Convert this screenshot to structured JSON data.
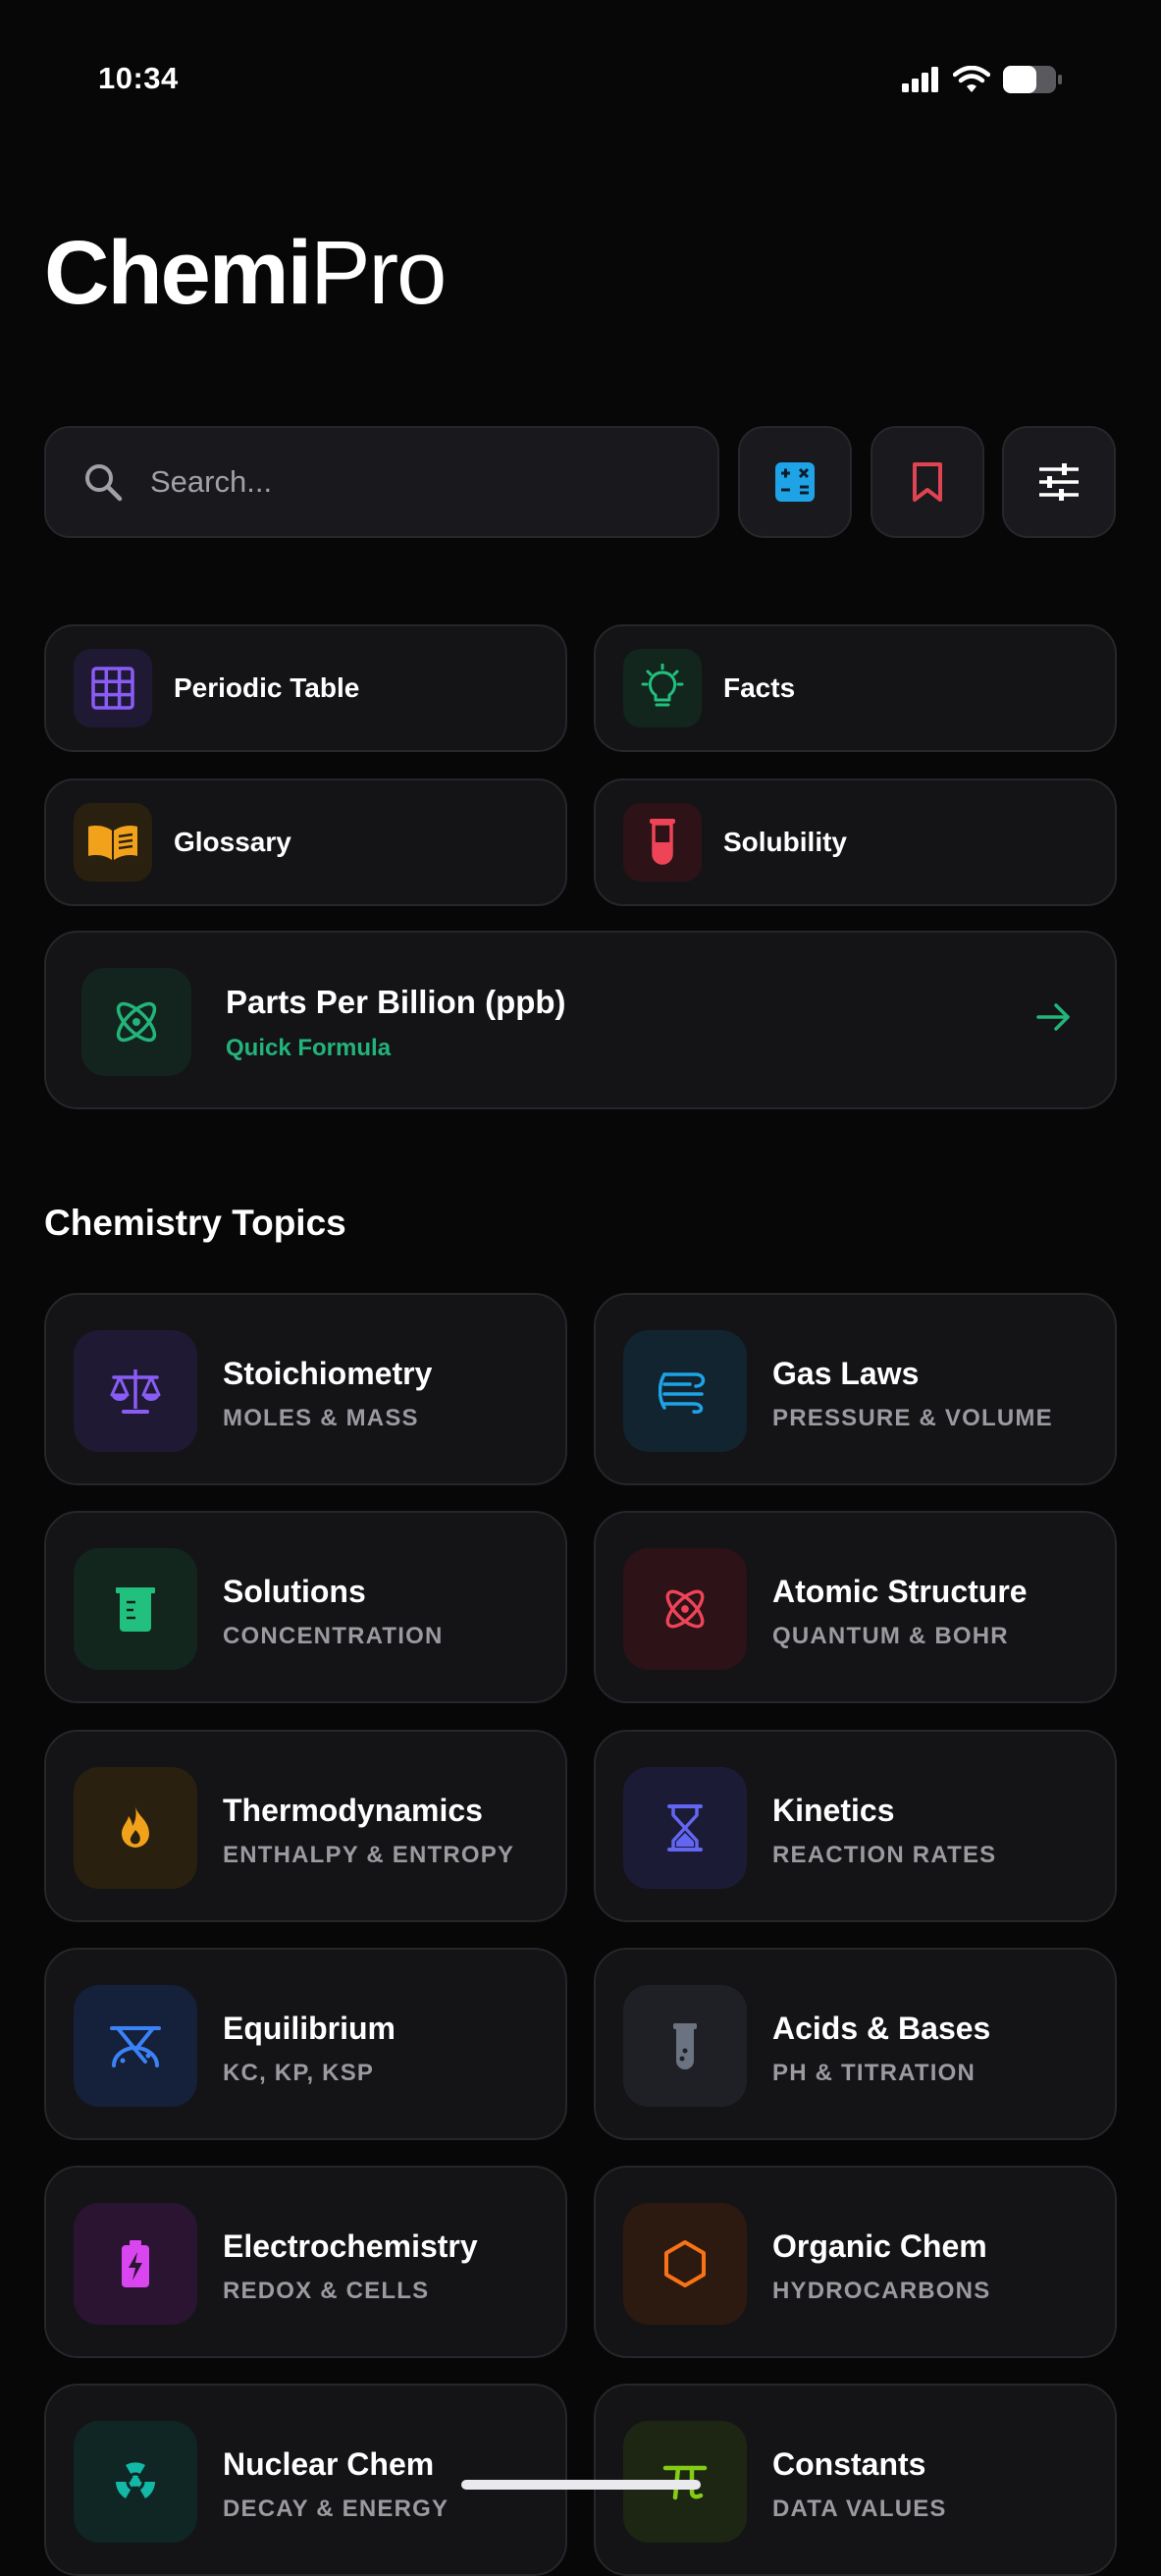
{
  "status_bar": {
    "time": "10:34"
  },
  "app": {
    "name_bold": "Chemi",
    "name_light": "Pro"
  },
  "search": {
    "placeholder": "Search..."
  },
  "toolbar": [
    {
      "icon": "calculator-icon",
      "color": "#1ea3e6"
    },
    {
      "icon": "bookmark-icon",
      "color": "#e04352"
    },
    {
      "icon": "sliders-icon",
      "color": "#ffffff"
    }
  ],
  "quick_links": [
    {
      "label": "Periodic Table",
      "icon": "grid-icon",
      "color": "#8a5cf6"
    },
    {
      "label": "Facts",
      "icon": "lightbulb-icon",
      "color": "#22c07f"
    },
    {
      "label": "Glossary",
      "icon": "book-icon",
      "color": "#f2a21a"
    },
    {
      "label": "Solubility",
      "icon": "test-tube-icon",
      "color": "#ef4458"
    }
  ],
  "featured": {
    "title": "Parts Per Billion (ppb)",
    "subtitle": "Quick Formula",
    "accent": "#22b47a"
  },
  "topics_heading": "Chemistry Topics",
  "topics": [
    {
      "name": "Stoichiometry",
      "sub": "MOLES & MASS",
      "icon": "scale-icon",
      "color": "#8a5cf6"
    },
    {
      "name": "Gas Laws",
      "sub": "PRESSURE & VOLUME",
      "icon": "wind-icon",
      "color": "#1ea3e6"
    },
    {
      "name": "Solutions",
      "sub": "CONCENTRATION",
      "icon": "beaker-icon",
      "color": "#22c07f"
    },
    {
      "name": "Atomic Structure",
      "sub": "QUANTUM & BOHR",
      "icon": "atom-icon",
      "color": "#ef4458"
    },
    {
      "name": "Thermodynamics",
      "sub": "ENTHALPY & ENTROPY",
      "icon": "flame-icon",
      "color": "#f2a21a"
    },
    {
      "name": "Kinetics",
      "sub": "REACTION RATES",
      "icon": "hourglass-icon",
      "color": "#6366f1"
    },
    {
      "name": "Equilibrium",
      "sub": "KC, KP, KSP",
      "icon": "balance-icon",
      "color": "#3b82f6"
    },
    {
      "name": "Acids & Bases",
      "sub": "PH & TITRATION",
      "icon": "vial-icon",
      "color": "#6b7280"
    },
    {
      "name": "Electrochemistry",
      "sub": "REDOX & CELLS",
      "icon": "battery-icon",
      "color": "#d946ef"
    },
    {
      "name": "Organic Chem",
      "sub": "HYDROCARBONS",
      "icon": "hexagon-icon",
      "color": "#f97316"
    },
    {
      "name": "Nuclear Chem",
      "sub": "DECAY & ENERGY",
      "icon": "radiation-icon",
      "color": "#14b8a6"
    },
    {
      "name": "Constants",
      "sub": "DATA VALUES",
      "icon": "pi-icon",
      "color": "#84cc16"
    }
  ]
}
